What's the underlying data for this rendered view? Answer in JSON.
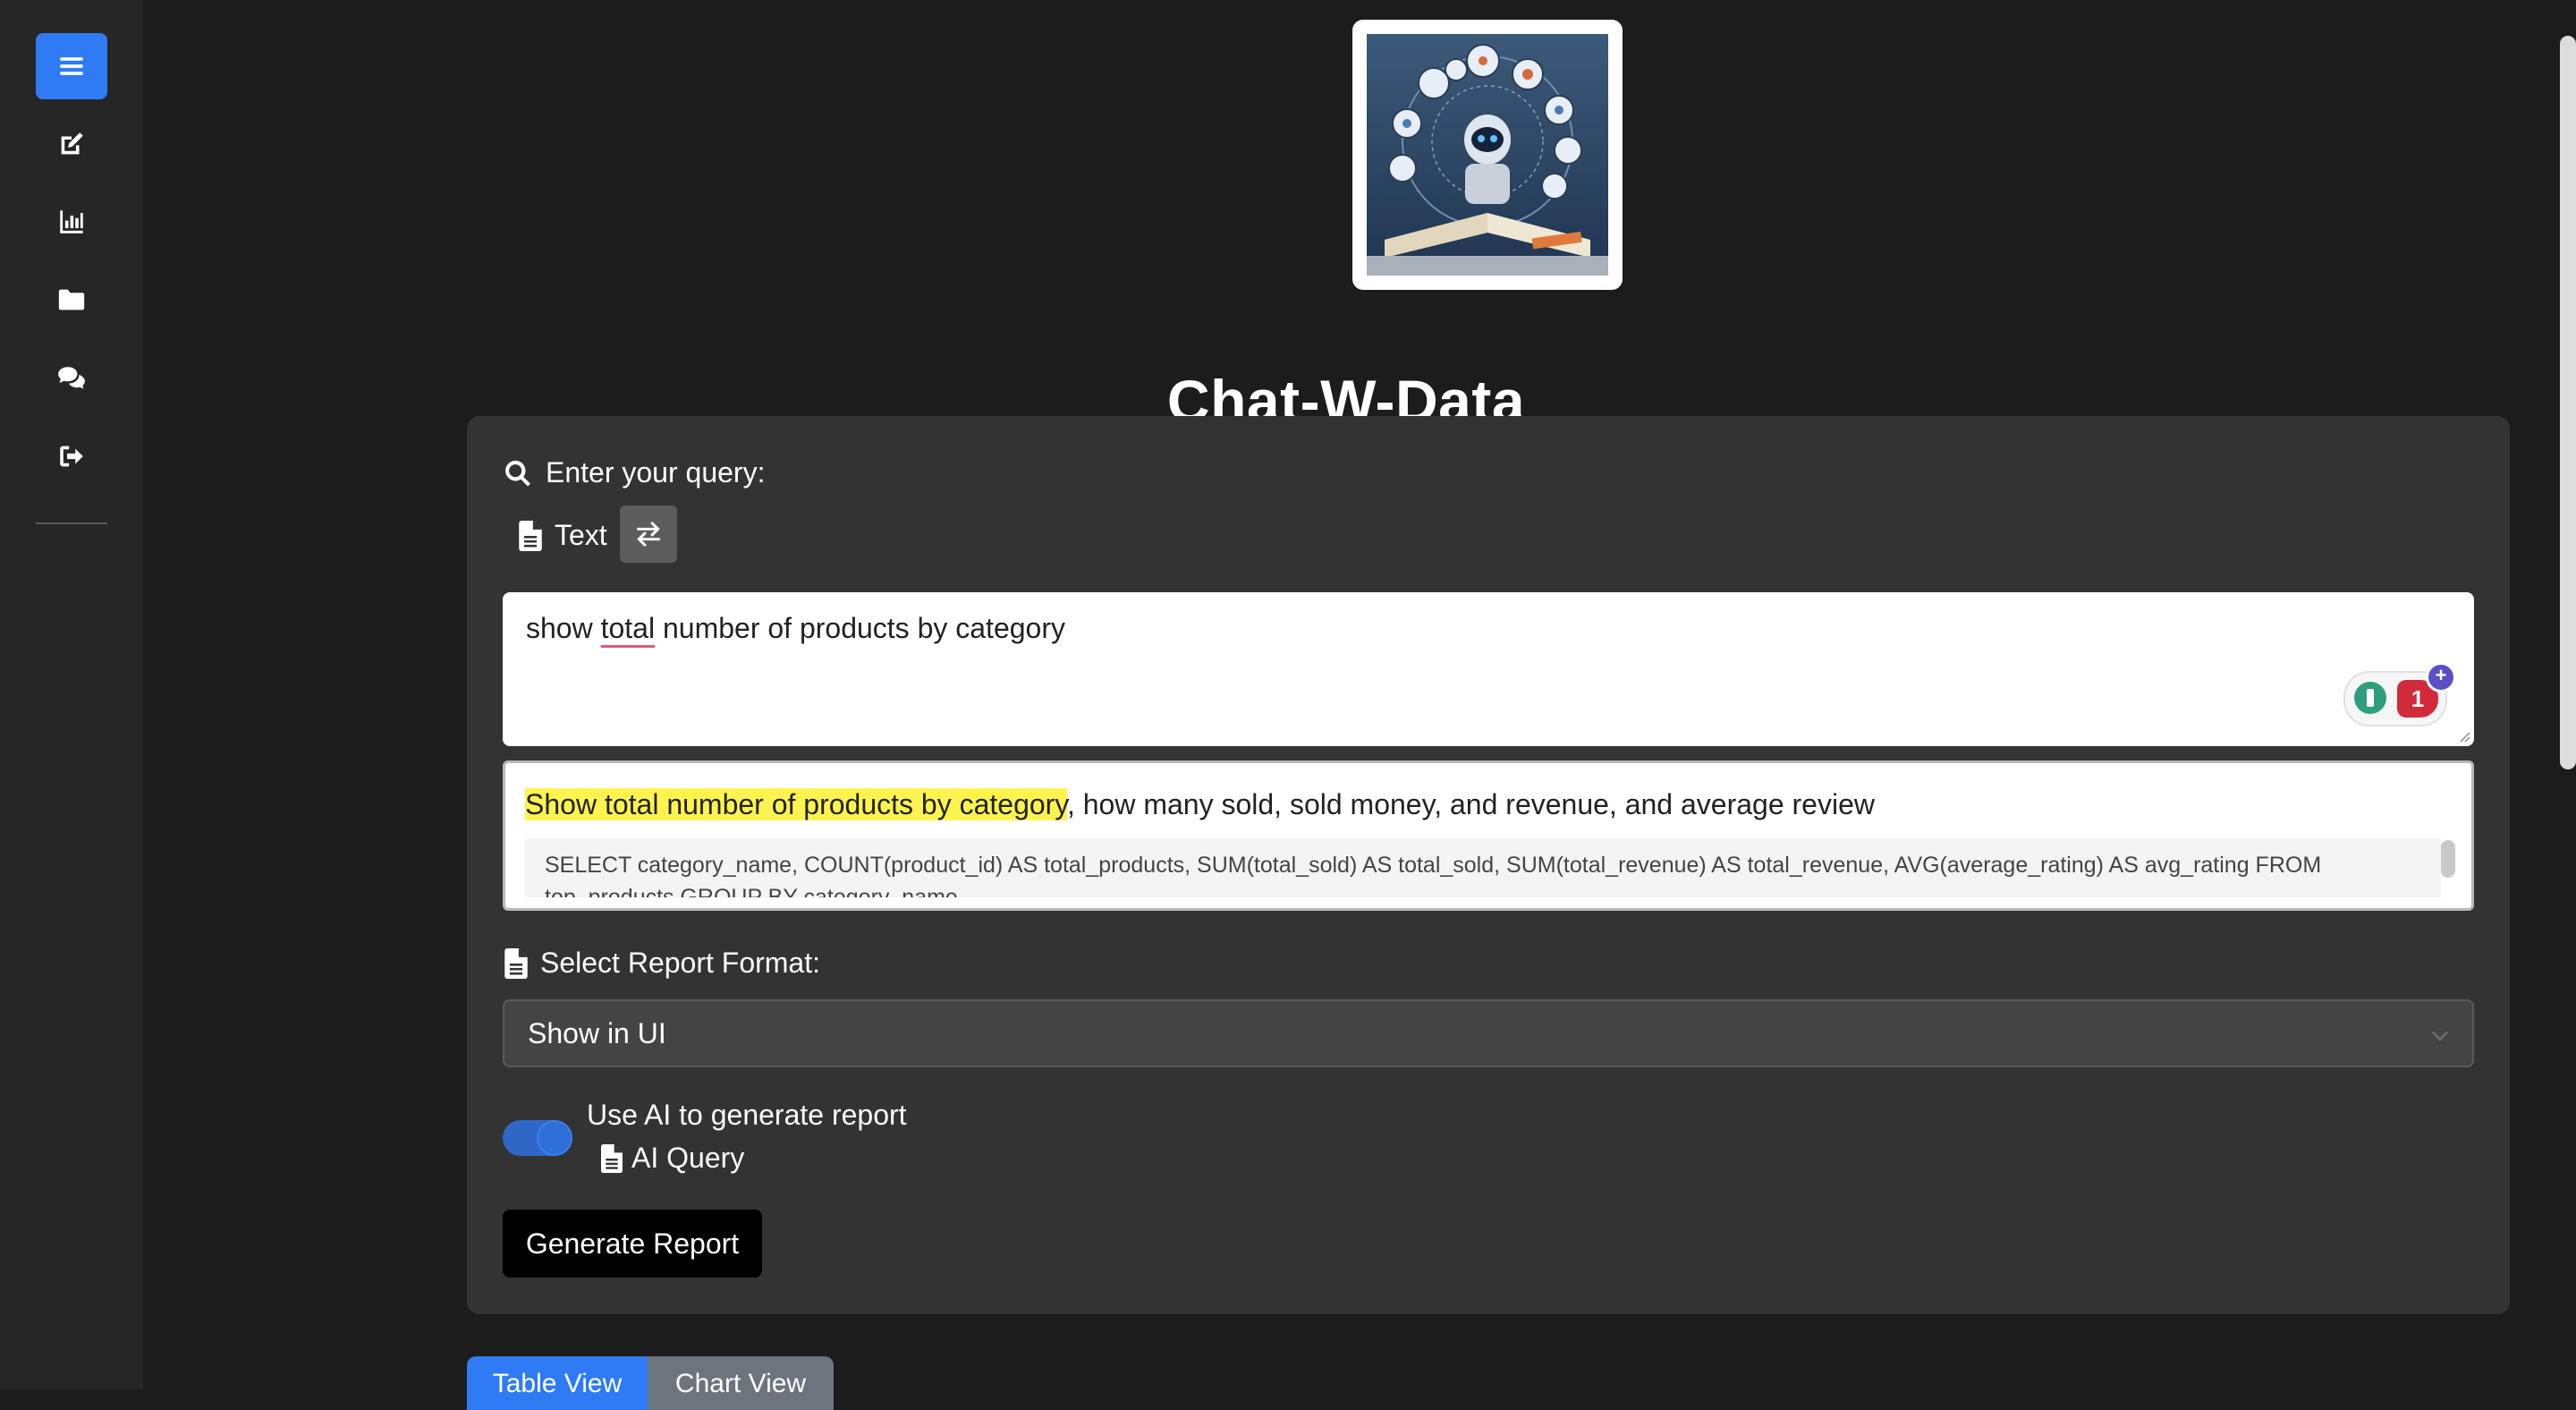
{
  "app": {
    "title": "Chat-W-Data"
  },
  "sidebar": {
    "items": [
      {
        "icon": "menu-icon",
        "active": true
      },
      {
        "icon": "edit-icon"
      },
      {
        "icon": "bar-chart-icon"
      },
      {
        "icon": "folder-icon"
      },
      {
        "icon": "chat-icon"
      },
      {
        "icon": "logout-icon"
      }
    ]
  },
  "query": {
    "label": "Enter your query:",
    "mode_label": "Text",
    "value_before": "show ",
    "value_underlined": "total",
    "value_after": " number of products by category",
    "extension_badge_count": "1"
  },
  "suggestion": {
    "highlighted": "Show total number of products by category",
    "rest": ", how many sold, sold money, and revenue, and average review",
    "sql": "SELECT category_name, COUNT(product_id) AS total_products, SUM(total_sold) AS total_sold, SUM(total_revenue) AS total_revenue, AVG(average_rating) AS avg_rating FROM top_products GROUP BY category_name"
  },
  "report": {
    "format_label": "Select Report Format:",
    "format_value": "Show in UI",
    "ai_toggle_label": "Use AI to generate report",
    "ai_toggle_on": true,
    "ai_query_label": "AI Query",
    "generate_label": "Generate Report"
  },
  "tabs": [
    {
      "label": "Table View",
      "active": true
    },
    {
      "label": "Chart View",
      "active": false
    }
  ],
  "colors": {
    "accent": "#2f7bf5",
    "background": "#1c1c1c",
    "panel": "#333333",
    "highlight": "#fff44f"
  }
}
